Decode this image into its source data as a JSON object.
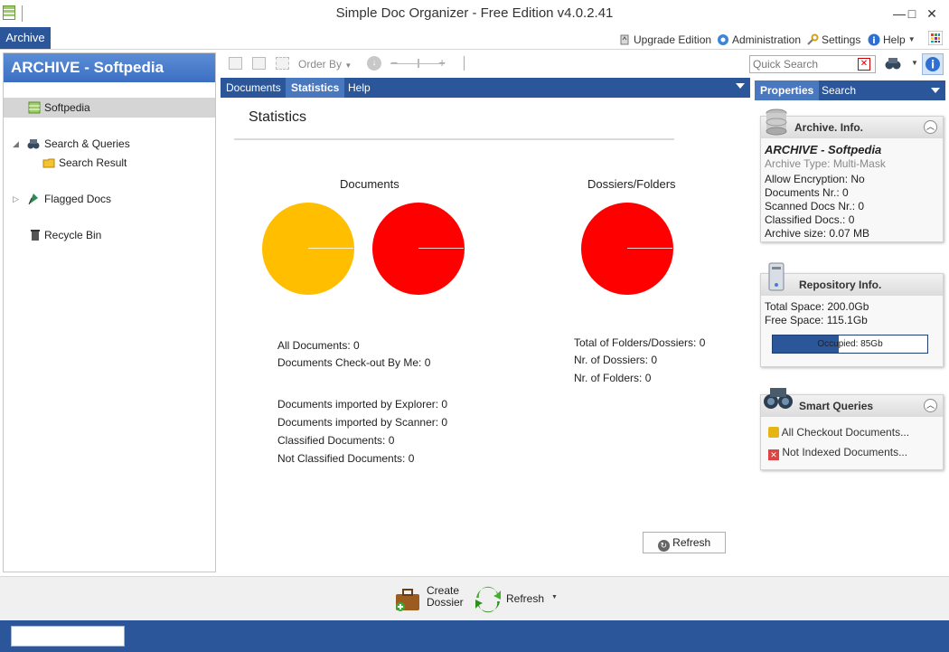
{
  "window": {
    "title": "Simple Doc Organizer - Free Edition v4.0.2.41",
    "minimize": "—",
    "maximize": "□",
    "close": "✕"
  },
  "menu": {
    "archive": "Archive"
  },
  "top_links": {
    "upgrade": "Upgrade Edition",
    "administration": "Administration",
    "settings": "Settings",
    "help": "Help"
  },
  "left_panel": {
    "header": "ARCHIVE - Softpedia",
    "items": [
      {
        "label": "Softpedia",
        "icon": "archive-icon"
      },
      {
        "label": "Search & Queries",
        "icon": "binoculars-icon"
      },
      {
        "label": "Search Result",
        "icon": "folder-icon"
      },
      {
        "label": "Flagged Docs",
        "icon": "flag-icon"
      },
      {
        "label": "Recycle Bin",
        "icon": "trash-icon"
      }
    ]
  },
  "toolbar": {
    "order_by": "Order By"
  },
  "tabs": [
    "Documents",
    "Statistics",
    "Help"
  ],
  "statistics": {
    "title": "Statistics",
    "documents_label": "Documents",
    "dossiers_label": "Dossiers/Folders",
    "doc_lines_a": [
      "All Documents: 0",
      "Documents Check-out By Me: 0"
    ],
    "doc_lines_b": [
      "Documents imported by Explorer: 0",
      "Documents imported by Scanner: 0",
      "Classified Documents: 0",
      "Not Classified Documents: 0"
    ],
    "folder_lines": [
      "Total of Folders/Dossiers: 0",
      "Nr. of Dossiers: 0",
      "Nr. of Folders: 0"
    ],
    "refresh": "Refresh",
    "colors": {
      "pie_orange": "#ffbf00",
      "pie_red": "#ff0000"
    }
  },
  "right_panel": {
    "tabs": [
      "Properties",
      "Search"
    ],
    "quick_search_placeholder": "Quick Search",
    "archive_info": {
      "title": "Archive. Info.",
      "name": "ARCHIVE - Softpedia",
      "type": "Archive Type: Multi-Mask",
      "lines": [
        "Allow Encryption: No",
        "Documents Nr.:  0",
        "Scanned Docs Nr.:  0",
        "Classified Docs.:  0",
        "Archive size: 0.07 MB"
      ]
    },
    "repository_info": {
      "title": "Repository Info.",
      "total": "Total Space: 200.0Gb",
      "free": "Free Space: 115.1Gb",
      "occupied_label": "Occupied: 85Gb",
      "occupied_fraction": 0.425
    },
    "smart_queries": {
      "title": "Smart Queries",
      "items": [
        "All Checkout Documents...",
        "Not Indexed Documents..."
      ]
    }
  },
  "bottom_toolbar": {
    "create_line1": "Create",
    "create_line2": "Dossier",
    "refresh": "Refresh"
  }
}
